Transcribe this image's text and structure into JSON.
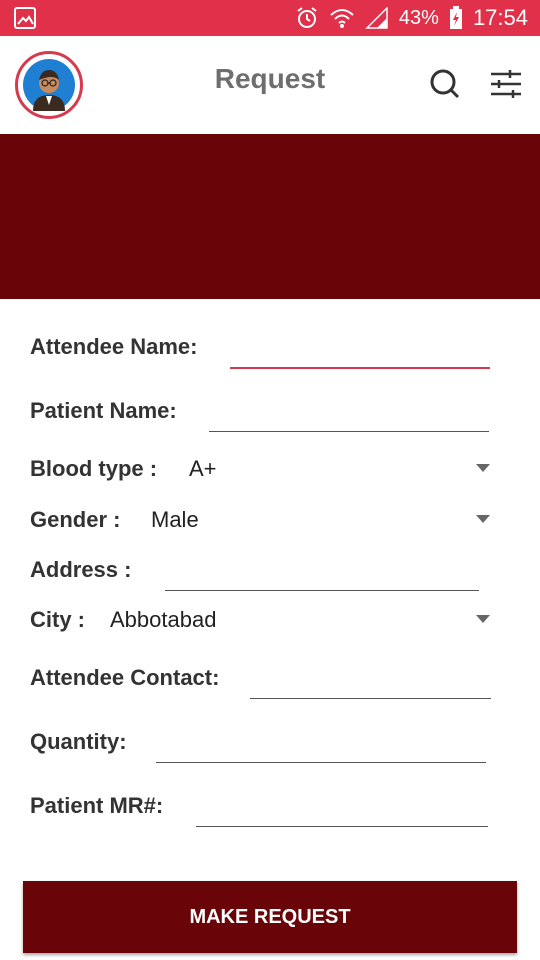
{
  "status_bar": {
    "battery_percent": "43%",
    "time": "17:54",
    "icons": [
      "gallery-icon",
      "alarm-icon",
      "wifi-icon",
      "signal-icon",
      "battery-charging-icon"
    ]
  },
  "app_bar": {
    "title": "Request",
    "avatar_icon": "avatar-icon",
    "search_icon": "search-icon",
    "filter_icon": "filter-icon"
  },
  "colors": {
    "status_bar": "#e0304a",
    "banner": "#690408",
    "button": "#690408",
    "accent": "#d43b4e"
  },
  "form": {
    "attendee_name": {
      "label": "Attendee Name:",
      "value": ""
    },
    "patient_name": {
      "label": "Patient Name:",
      "value": ""
    },
    "blood_type": {
      "label": "Blood type :",
      "value": "A+"
    },
    "gender": {
      "label": "Gender :",
      "value": "Male"
    },
    "address": {
      "label": "Address :",
      "value": ""
    },
    "city": {
      "label": "City :",
      "value": "Abbotabad"
    },
    "attendee_contact": {
      "label": "Attendee Contact:",
      "value": ""
    },
    "quantity": {
      "label": "Quantity:",
      "value": ""
    },
    "patient_mr": {
      "label": "Patient MR#:",
      "value": ""
    }
  },
  "submit_label": "MAKE REQUEST"
}
